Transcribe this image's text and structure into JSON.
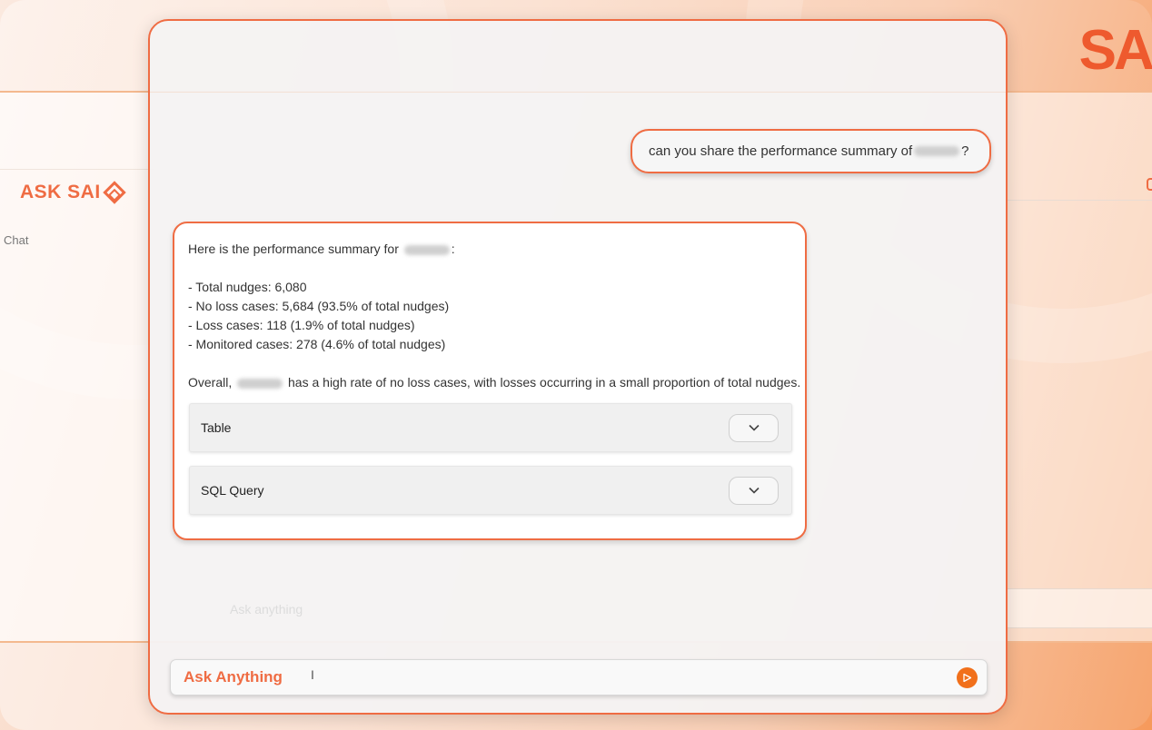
{
  "brand": {
    "logo_text": "SAI",
    "ask_logo_text": "ASK SAI"
  },
  "background": {
    "sidebar_item": "Chat",
    "ghost_input_placeholder": "Ask anything"
  },
  "chat": {
    "user_message": {
      "prefix": "can you share the performance summary of",
      "suffix": "?"
    },
    "bot_message": {
      "intro_prefix": "Here is the performance summary for",
      "intro_suffix": ":",
      "bullets": [
        "- Total nudges: 6,080",
        "- No loss cases: 5,684 (93.5% of total nudges)",
        "- Loss cases: 118 (1.9% of total nudges)",
        "- Monitored cases: 278 (4.6% of total nudges)"
      ],
      "overall_prefix": "Overall,",
      "overall_suffix": "has a high rate of no loss cases, with losses occurring in a small proportion of total nudges."
    },
    "accordions": [
      {
        "label": "Table"
      },
      {
        "label": "SQL Query"
      }
    ]
  },
  "input": {
    "placeholder": "Ask Anything",
    "value": ""
  },
  "colors": {
    "accent": "#ef6c43",
    "send": "#f1701b"
  }
}
